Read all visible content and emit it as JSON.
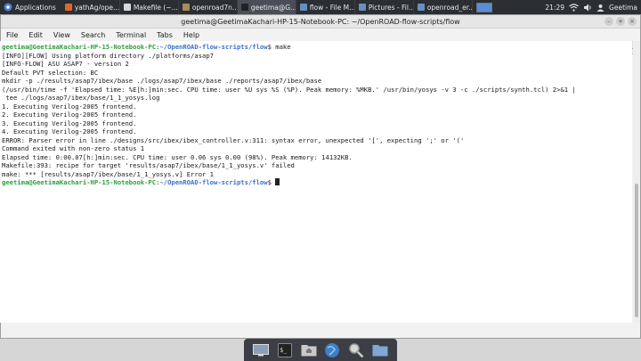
{
  "panel": {
    "apps_label": "Applications",
    "tasks": [
      {
        "label": "yathAg/ope...",
        "color": "#e0662b",
        "active": false
      },
      {
        "label": "Makefile (~...",
        "color": "#d9d9d9",
        "active": false
      },
      {
        "label": "openroad7n...",
        "color": "#a88c5a",
        "active": false
      },
      {
        "label": "geetima@G...",
        "color": "#222222",
        "active": true
      },
      {
        "label": "flow - File M...",
        "color": "#6a8fbf",
        "active": false
      },
      {
        "label": "Pictures - Fil...",
        "color": "#6a8fbf",
        "active": false
      },
      {
        "label": "openroad_er...",
        "color": "#6a8fbf",
        "active": false
      }
    ],
    "clock": "21:29",
    "user": "Geetima"
  },
  "window": {
    "title": "geetima@GeetimaKachari-HP-15-Notebook-PC: ~/OpenROAD-flow-scripts/flow",
    "menu": [
      "File",
      "Edit",
      "View",
      "Search",
      "Terminal",
      "Tabs",
      "Help"
    ],
    "tabs": [
      {
        "label": "geetima@GeetimaKachari-HP-15-Notebook-PC: ~/OpenR...",
        "active": false
      },
      {
        "label": "geetima@GeetimaKachari-HP-15-Notebook-PC: ~/OpenR...",
        "active": false
      },
      {
        "label": "geetima@GeetimaKachari-HP-15-Notebook-PC: ~/OpenR...",
        "active": true
      }
    ]
  },
  "terminal": {
    "prompt_user": "geetima@GeetimaKachari-HP-15-Notebook-PC",
    "prompt_path": "~/OpenROAD-flow-scripts/flow",
    "command": "make",
    "output": [
      "[INFO][FLOW] Using platform directory ./platforms/asap7",
      "[INFO-FLOW] ASU ASAP7 - version 2",
      "Default PVT selection: BC",
      "mkdir -p ./results/asap7/ibex/base ./logs/asap7/ibex/base ./reports/asap7/ibex/base",
      "(/usr/bin/time -f 'Elapsed time: %E[h:]min:sec. CPU time: user %U sys %S (%P). Peak memory: %MKB.' /usr/bin/yosys -v 3 -c ./scripts/synth.tcl) 2>&1 |",
      " tee ./logs/asap7/ibex/base/1_1_yosys.log",
      "1. Executing Verilog-2005 frontend.",
      "2. Executing Verilog-2005 frontend.",
      "3. Executing Verilog-2005 frontend.",
      "4. Executing Verilog-2005 frontend.",
      "ERROR: Parser error in line ./designs/src/ibex/ibex_controller.v:311: syntax error, unexpected '[', expecting ';' or '('",
      "Command exited with non-zero status 1",
      "Elapsed time: 0:00.07[h:]min:sec. CPU time: user 0.06 sys 0.00 (98%). Peak memory: 14132KB.",
      "Makefile:393: recipe for target 'results/asap7/ibex/base/1_1_yosys.v' failed",
      "make: *** [results/asap7/ibex/base/1_1_yosys.v] Error 1"
    ]
  }
}
